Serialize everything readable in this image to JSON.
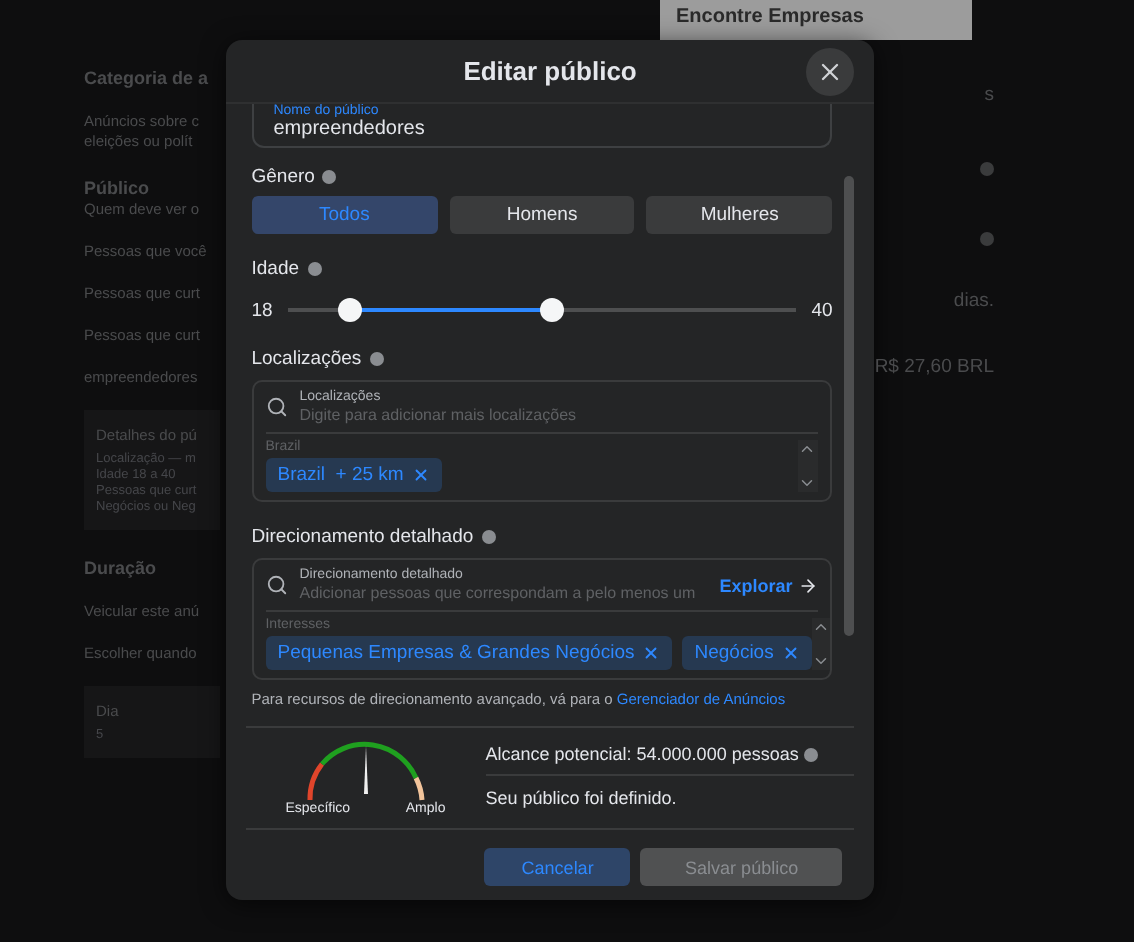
{
  "background": {
    "top_box": "Encontre Empresas",
    "left": [
      {
        "kind": "heading",
        "text": "Categoria de a"
      },
      {
        "kind": "text",
        "text": "Anúncios sobre c"
      },
      {
        "kind": "line",
        "text": "eleições ou polít"
      },
      {
        "kind": "heading",
        "text": "Público"
      },
      {
        "kind": "line",
        "text": "Quem deve ver o"
      },
      {
        "kind": "text",
        "text": "Pessoas que você"
      },
      {
        "kind": "text",
        "text": "Pessoas que curt"
      },
      {
        "kind": "text",
        "text": "Pessoas que curt"
      },
      {
        "kind": "text",
        "text": "empreendedores"
      },
      {
        "kind": "card",
        "title": "Detalhes do pú",
        "lines": [
          "Localização — m",
          "Idade 18 a 40",
          "Pessoas que curt",
          "Negócios ou Neg"
        ]
      },
      {
        "kind": "heading",
        "text": "Duração"
      },
      {
        "kind": "text",
        "text": "Veicular este anú"
      },
      {
        "kind": "text",
        "text": "Escolher quando"
      },
      {
        "kind": "card",
        "title": "Dia",
        "lines": [
          "5"
        ]
      }
    ],
    "right": [
      {
        "kind": "text",
        "text": "s"
      },
      {
        "kind": "info"
      },
      {
        "kind": "info"
      },
      {
        "kind": "text",
        "text": "dias."
      },
      {
        "kind": "text",
        "text": "R$ 27,60 BRL"
      }
    ]
  },
  "modal": {
    "title": "Editar público",
    "name_field": {
      "label": "Nome do público",
      "value": "empreendedores"
    },
    "gender": {
      "label": "Gênero",
      "options": [
        {
          "label": "Todos",
          "selected": true
        },
        {
          "label": "Homens",
          "selected": false
        },
        {
          "label": "Mulheres",
          "selected": false
        }
      ]
    },
    "age": {
      "label": "Idade",
      "min": "18",
      "max": "40",
      "thumbs": [
        {
          "level": 0.12
        },
        {
          "level": 0.52
        }
      ]
    },
    "locations": {
      "label": "Localizações",
      "field_label": "Localizações",
      "placeholder": "Digite para adicionar mais localizações",
      "group_label": "Brazil",
      "chips": [
        "Brazil  + 25 km"
      ]
    },
    "detailed": {
      "label": "Direcionamento detalhado",
      "field_label": "Direcionamento detalhado",
      "placeholder": "Adicionar pessoas que correspondam a pelo menos um",
      "explore": "Explorar",
      "group_label": "Interesses",
      "chips": [
        "Pequenas Empresas & Grandes Negócios",
        "Negócios"
      ]
    },
    "note": {
      "text": "Para recursos de direcionamento avançado, vá para o",
      "link": "Gerenciador de Anúncios"
    },
    "gauge": {
      "min_label": "Específico",
      "max_label": "Amplo"
    },
    "reach": "Alcance potencial: 54.000.000 pessoas",
    "status": "Seu público foi definido.",
    "buttons": [
      {
        "label": "Cancelar",
        "disabled": false
      },
      {
        "label": "Salvar público",
        "disabled": true
      }
    ]
  }
}
